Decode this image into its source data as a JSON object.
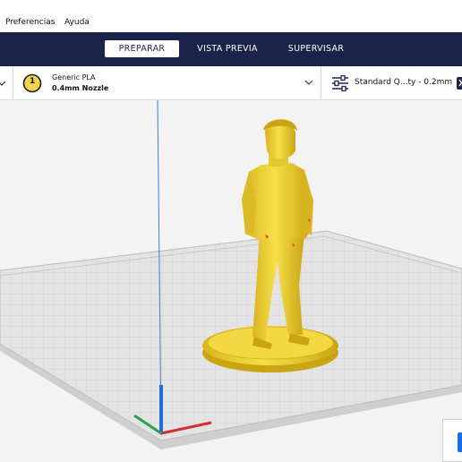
{
  "menu": {
    "items": [
      "Preferencias",
      "Ayuda"
    ]
  },
  "stages": {
    "prepare": "PREPARAR",
    "preview": "VISTA PREVIA",
    "monitor": "SUPERVISAR",
    "active": "prepare"
  },
  "extruder": {
    "number": "1",
    "material": "Generic PLA",
    "nozzle": "0.4mm Nozzle"
  },
  "print_settings": {
    "profile": "Standard Q...ty - 0.2mm"
  },
  "colors": {
    "topbar": "#1c234a",
    "model": "#f5d83a",
    "extruder_badge": "#f1d44a",
    "axis_x": "#d32f2f",
    "axis_y": "#1e6fd6",
    "axis_z": "#2e9e4b"
  },
  "icons": {
    "extruder": "numbered-circle-icon",
    "settings": "sliders-icon",
    "dropdown": "chevron-down-icon"
  }
}
